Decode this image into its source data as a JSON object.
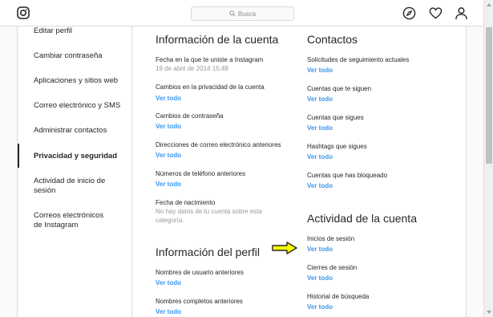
{
  "topbar": {
    "search_placeholder": "Busca"
  },
  "sidebar": {
    "items": [
      {
        "label": "Editar perfil"
      },
      {
        "label": "Cambiar contraseña"
      },
      {
        "label": "Aplicaciones y sitios web"
      },
      {
        "label": "Correo electrónico y SMS"
      },
      {
        "label": "Administrar contactos"
      },
      {
        "label": "Privacidad y seguridad"
      },
      {
        "label": "Actividad de inicio de sesión"
      },
      {
        "label": "Correos electrónicos de Instagram"
      }
    ]
  },
  "account_info": {
    "title": "Información de la cuenta",
    "join_date_label": "Fecha en la que te uniste a Instagram",
    "join_date_value": "19 de abril de 2014 15:48",
    "privacy_changes_label": "Cambios en la privacidad de la cuenta",
    "password_changes_label": "Cambios de contraseña",
    "emails_label": "Direcciones de correo electrónico anteriores",
    "phones_label": "Números de teléfono anteriores",
    "birthdate_label": "Fecha de nacimiento",
    "birthdate_note_1": "No hay datos de tu cuenta sobre esta",
    "birthdate_note_2": "categoría."
  },
  "profile_info": {
    "title": "Información del perfil",
    "usernames_label": "Nombres de usuario anteriores",
    "fullnames_label": "Nombres completos anteriores"
  },
  "contacts": {
    "title": "Contactos",
    "follow_requests_label": "Solicitudes de seguimiento actuales",
    "followers_label": "Cuentas que te siguen",
    "following_label": "Cuentas que sigues",
    "hashtags_label": "Hashtags que sigues",
    "blocked_label": "Cuentas que has bloqueado"
  },
  "account_activity": {
    "title": "Actividad de la cuenta",
    "logins_label": "Inicios de sesión",
    "logouts_label": "Cierres de sesión",
    "search_history_label": "Historial de búsqueda"
  },
  "common": {
    "view_all": "Ver todo"
  },
  "colors": {
    "link": "#3897f0",
    "arrow_fill": "#ffff00"
  }
}
